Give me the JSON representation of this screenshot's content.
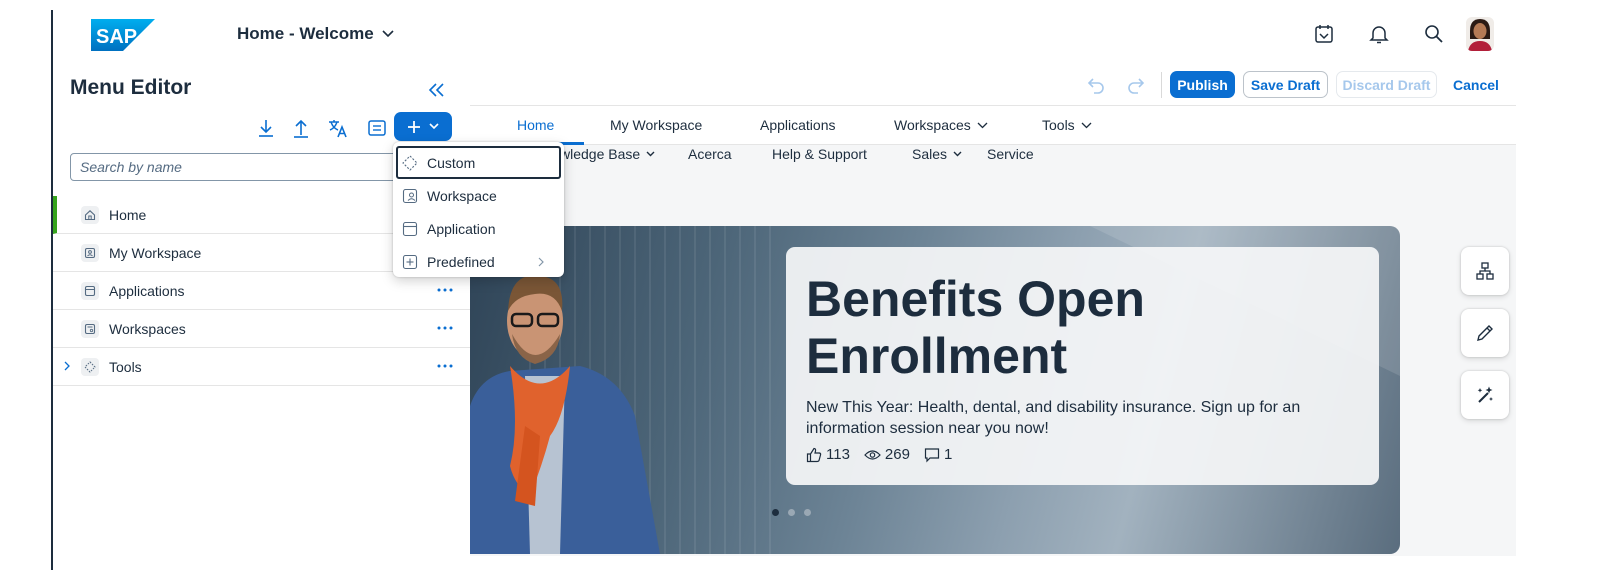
{
  "colors": {
    "accent": "#0a6ed1",
    "selected_marker": "#36a41d",
    "text": "#1d2d3e"
  },
  "shell": {
    "logo_text": "SAP",
    "app_title": "Home - Welcome",
    "icons": [
      "notification-tray-icon",
      "bell-icon",
      "search-icon",
      "user-avatar"
    ]
  },
  "editor": {
    "title": "Menu Editor",
    "search_placeholder": "Search by name",
    "toolbar_icons": [
      "download-icon",
      "upload-icon",
      "translate-icon",
      "menu-list-icon",
      "add-icon"
    ],
    "items": [
      {
        "label": "Home",
        "icon": "home-icon",
        "selected": true
      },
      {
        "label": "My Workspace",
        "icon": "workspace-icon"
      },
      {
        "label": "Applications",
        "icon": "application-icon"
      },
      {
        "label": "Workspaces",
        "icon": "workspaces-icon"
      },
      {
        "label": "Tools",
        "icon": "custom-icon",
        "expandable": true
      }
    ],
    "add_menu": [
      {
        "label": "Custom",
        "icon": "custom-icon",
        "focused": true
      },
      {
        "label": "Workspace",
        "icon": "workspace-icon"
      },
      {
        "label": "Application",
        "icon": "application-icon"
      },
      {
        "label": "Predefined",
        "icon": "add-box-icon",
        "submenu": true
      }
    ]
  },
  "actions": {
    "publish": "Publish",
    "save_draft": "Save Draft",
    "discard_draft": "Discard Draft",
    "cancel": "Cancel"
  },
  "nav": {
    "level1": [
      {
        "label": "Home",
        "active": true
      },
      {
        "label": "My Workspace"
      },
      {
        "label": "Applications"
      },
      {
        "label": "Workspaces",
        "dropdown": true
      },
      {
        "label": "Tools",
        "dropdown": true
      }
    ],
    "level2": [
      {
        "label": "Knowledge Base",
        "visible_text": "wledge Base",
        "dropdown": true
      },
      {
        "label": "Acerca"
      },
      {
        "label": "Help & Support"
      },
      {
        "label": "Sales",
        "dropdown": true
      },
      {
        "label": "Service"
      }
    ]
  },
  "banner": {
    "title": "Benefits Open Enrollment",
    "text": "New This Year: Health, dental, and disability insurance. Sign up for an information session near you now!",
    "likes": "113",
    "views": "269",
    "comments": "1",
    "carousel_pages": 3,
    "carousel_active": 1
  },
  "side_actions": [
    "hierarchy-icon",
    "edit-icon",
    "ai-sparkle-icon"
  ]
}
